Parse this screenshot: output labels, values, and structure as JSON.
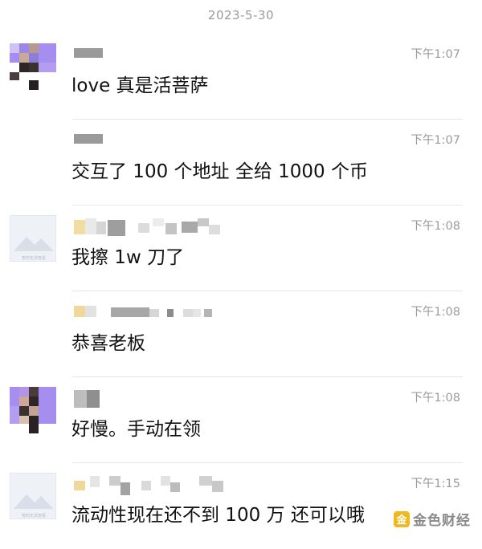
{
  "date_separator": "2023-5-30",
  "messages": [
    {
      "time": "下午1:07",
      "text": "love 真是活菩萨"
    },
    {
      "time": "下午1:07",
      "text": "交互了 100 个地址 全给 1000 个币"
    },
    {
      "time": "下午1:08",
      "text": "我擦 1w 刀了"
    },
    {
      "time": "下午1:08",
      "text": "恭喜老板"
    },
    {
      "time": "下午1:08",
      "text": "好慢。手动在领"
    },
    {
      "time": "下午1:15",
      "text": "流动性现在还不到 100 万 还可以哦"
    }
  ],
  "placeholder_avatar_text": "暂时无法查看",
  "watermark": {
    "text": "金色财经",
    "logo_glyph": "金"
  },
  "colors": {
    "purple": "#a58ef0",
    "dark": "#3a2e2e",
    "watermark_gold": "#f1b81e"
  }
}
